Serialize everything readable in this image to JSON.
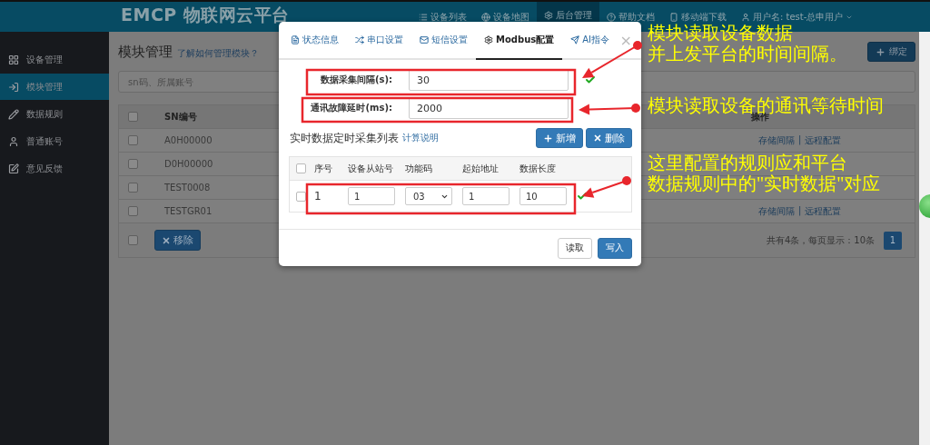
{
  "header": {
    "logo": "EMCP 物联网云平台",
    "nav": [
      {
        "label": "设备列表",
        "selected": false,
        "dropdown": false
      },
      {
        "label": "设备地图",
        "selected": false,
        "dropdown": false
      },
      {
        "label": "后台管理",
        "selected": true,
        "dropdown": false
      },
      {
        "label": "帮助文档",
        "selected": false,
        "dropdown": false
      },
      {
        "label": "移动端下载",
        "selected": false,
        "dropdown": false
      },
      {
        "label": "用户名: test-总申用户",
        "selected": false,
        "dropdown": true
      }
    ]
  },
  "sidebar": {
    "items": [
      {
        "label": "设备管理",
        "selected": false
      },
      {
        "label": "模块管理",
        "selected": true
      },
      {
        "label": "数据规则",
        "selected": false
      },
      {
        "label": "普通账号",
        "selected": false
      },
      {
        "label": "意见反馈",
        "selected": false
      }
    ]
  },
  "page": {
    "title": "模块管理",
    "help_link": "了解如何管理模块？",
    "bind_button": "绑定",
    "search": {
      "placeholder": "sn码、所属账号"
    },
    "table": {
      "columns": [
        "SN编号",
        "操作"
      ],
      "header_checked": false,
      "separator": "|",
      "rows": [
        {
          "sn": "A0H00000",
          "checked": false,
          "actions": [
            "存储间隔",
            "远程配置"
          ]
        },
        {
          "sn": "D0H00000",
          "checked": false
        },
        {
          "sn": "TEST0008",
          "checked": false
        },
        {
          "sn": "TESTGR01",
          "checked": false,
          "actions": [
            "存储间隔",
            "远程配置"
          ]
        }
      ],
      "footer_checked": false,
      "remove_button": "移除",
      "summary": "共有4条，每页显示：10条",
      "pages": [
        {
          "label": "1",
          "selected": true
        }
      ]
    }
  },
  "modal": {
    "tabs": [
      {
        "label": "状态信息",
        "selected": false
      },
      {
        "label": "串口设置",
        "selected": false
      },
      {
        "label": "短信设置",
        "selected": false
      },
      {
        "label": "Modbus配置",
        "selected": true
      },
      {
        "label": "AI指令",
        "selected": false
      }
    ],
    "close": "×",
    "fields": [
      {
        "label": "数据采集间隔(s):",
        "value": "30",
        "valid": true
      },
      {
        "label": "通讯故障延时(ms):",
        "value": "2000",
        "valid": false
      }
    ],
    "section_title": "实时数据定时采集列表",
    "section_link": "计算说明",
    "add_button": "新增",
    "delete_button": "删除",
    "table": {
      "columns": [
        "序号",
        "设备从站号",
        "功能码",
        "起始地址",
        "数据长度"
      ],
      "header_checked": false,
      "rows": [
        {
          "index": "1",
          "slave": "1",
          "function_code": "03",
          "start": "1",
          "length": "10",
          "checked": false,
          "valid": true
        }
      ]
    },
    "buttons": [
      {
        "label": "读取",
        "kind": "default"
      },
      {
        "label": "写入",
        "kind": "primary"
      }
    ]
  },
  "annotations": [
    {
      "lines": [
        "模块读取设备数据",
        "并上发平台的时间间隔。"
      ]
    },
    {
      "lines": [
        "模块读取设备的通讯等待时间"
      ]
    },
    {
      "lines": [
        "这里配置的规则应和平台",
        "数据规则中的\"实时数据\"对应"
      ]
    }
  ]
}
